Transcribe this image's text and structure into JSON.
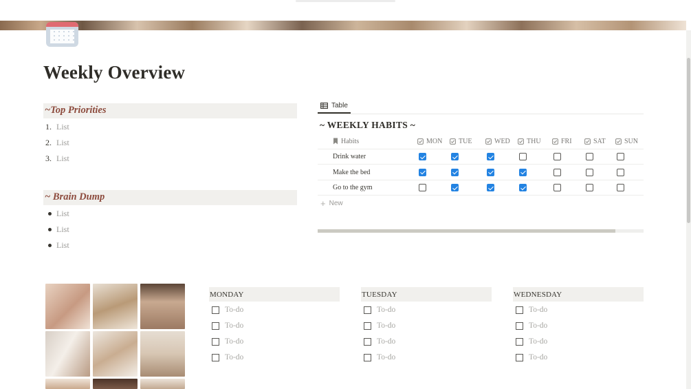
{
  "page": {
    "title": "Weekly Overview",
    "icon": "calendar-icon"
  },
  "top_priorities": {
    "heading": "~Top Priorities",
    "items": [
      {
        "marker": "1.",
        "text": "List"
      },
      {
        "marker": "2.",
        "text": "List"
      },
      {
        "marker": "3.",
        "text": "List"
      }
    ]
  },
  "brain_dump": {
    "heading": "~ Brain Dump",
    "items": [
      {
        "text": "List"
      },
      {
        "text": "List"
      },
      {
        "text": "List"
      }
    ]
  },
  "habits_table": {
    "view_tab": "Table",
    "title": "~ WEEKLY HABITS ~",
    "name_column": "Habits",
    "day_columns": [
      "MON",
      "TUE",
      "WED",
      "THU",
      "FRI",
      "SAT",
      "SUN"
    ],
    "rows": [
      {
        "habit": "Drink water",
        "checks": [
          true,
          true,
          true,
          false,
          false,
          false,
          false
        ]
      },
      {
        "habit": "Make the bed",
        "checks": [
          true,
          true,
          true,
          true,
          false,
          false,
          false
        ]
      },
      {
        "habit": "Go to the gym",
        "checks": [
          false,
          true,
          true,
          true,
          false,
          false,
          false
        ]
      }
    ],
    "new_label": "New",
    "checked_color": "#2383e2"
  },
  "days": [
    {
      "name": "MONDAY",
      "todos": [
        "To-do",
        "To-do",
        "To-do",
        "To-do"
      ]
    },
    {
      "name": "TUESDAY",
      "todos": [
        "To-do",
        "To-do",
        "To-do",
        "To-do"
      ]
    },
    {
      "name": "WEDNESDAY",
      "todos": [
        "To-do",
        "To-do",
        "To-do",
        "To-do"
      ]
    }
  ],
  "colors": {
    "heading_accent": "#8c4a3c",
    "section_bg": "#f1f0ed",
    "muted_text": "#9b9a97"
  }
}
